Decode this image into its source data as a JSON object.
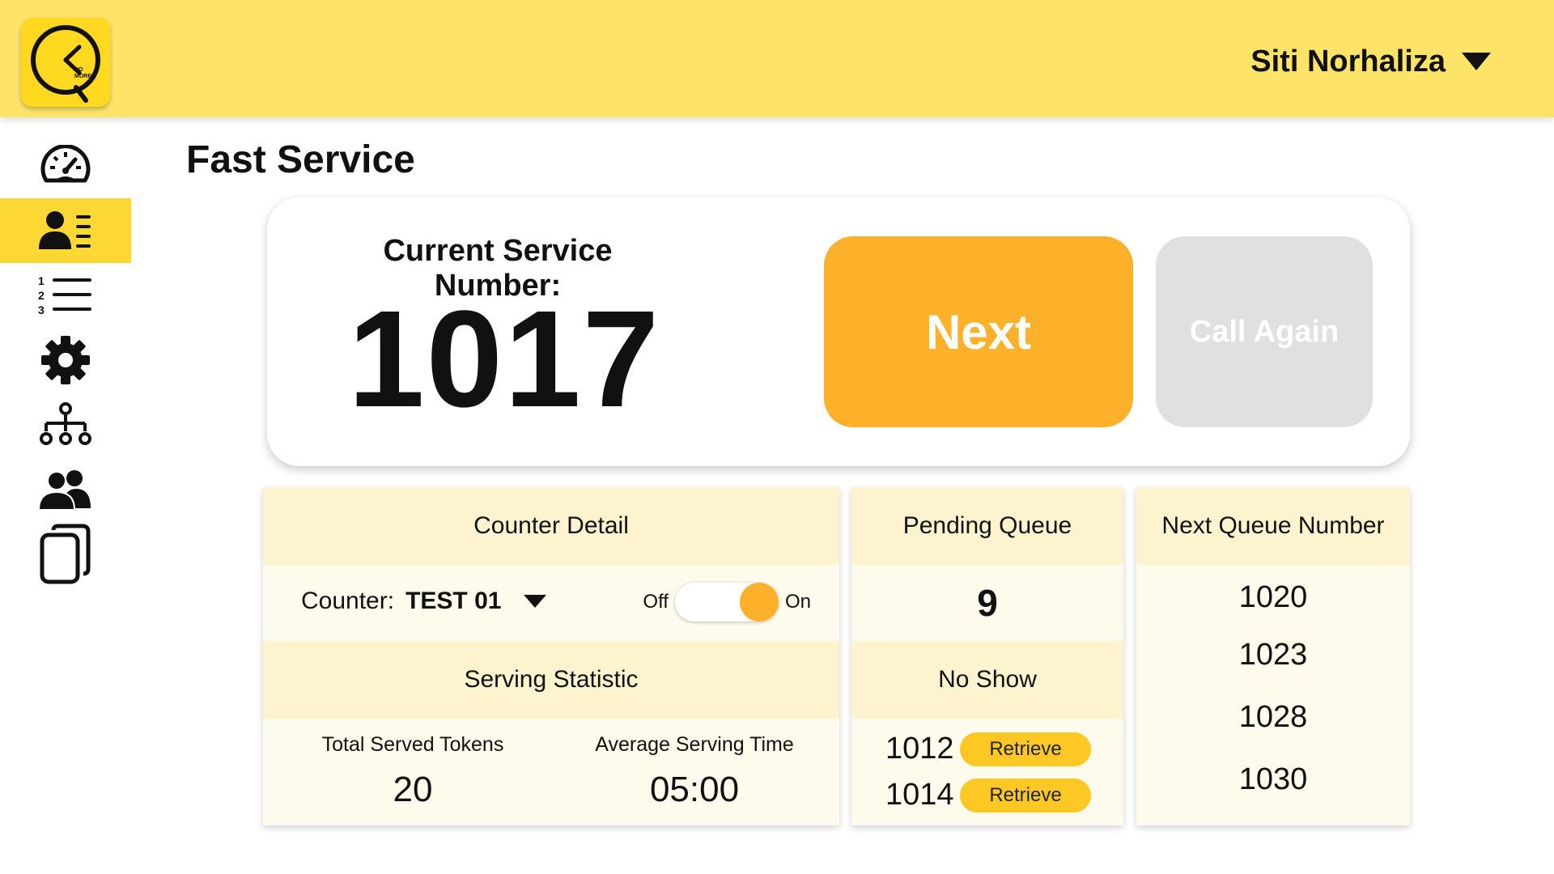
{
  "header": {
    "logo_text": "NO MORE",
    "user_name": "Siti Norhaliza"
  },
  "sidebar": {
    "items": [
      {
        "icon": "speedometer-icon",
        "active": false
      },
      {
        "icon": "contact-card-icon",
        "active": true
      },
      {
        "icon": "numbered-list-icon",
        "active": false,
        "numbers": [
          "1",
          "2",
          "3"
        ]
      },
      {
        "icon": "gear-icon",
        "active": false
      },
      {
        "icon": "org-chart-icon",
        "active": false
      },
      {
        "icon": "users-icon",
        "active": false
      },
      {
        "icon": "copy-icon",
        "active": false
      }
    ]
  },
  "page": {
    "title": "Fast Service"
  },
  "service": {
    "current_label": "Current Service Number:",
    "current_number": "1017",
    "next_label": "Next",
    "call_again_label": "Call Again"
  },
  "counter": {
    "header": "Counter Detail",
    "counter_prefix": "Counter:",
    "counter_value": "TEST 01",
    "toggle_off": "Off",
    "toggle_on": "On",
    "toggle_state": "on"
  },
  "stats": {
    "header": "Serving Statistic",
    "total_label": "Total Served Tokens",
    "total_value": "20",
    "avg_label": "Average Serving Time",
    "avg_value": "05:00"
  },
  "pending": {
    "header": "Pending Queue",
    "count": "9",
    "noshow_header": "No Show",
    "noshow": [
      {
        "number": "1012",
        "action": "Retrieve"
      },
      {
        "number": "1014",
        "action": "Retrieve"
      }
    ]
  },
  "next_queue": {
    "header": "Next Queue Number",
    "numbers": [
      "1020",
      "1023",
      "1028",
      "1030"
    ]
  },
  "colors": {
    "header_bg": "#fde468",
    "accent": "#fdb02a",
    "active_sidebar": "#fdd835",
    "panel_bg": "#fefbec",
    "panel_head_bg": "#fef3cf",
    "disabled": "#e0e0e0"
  }
}
